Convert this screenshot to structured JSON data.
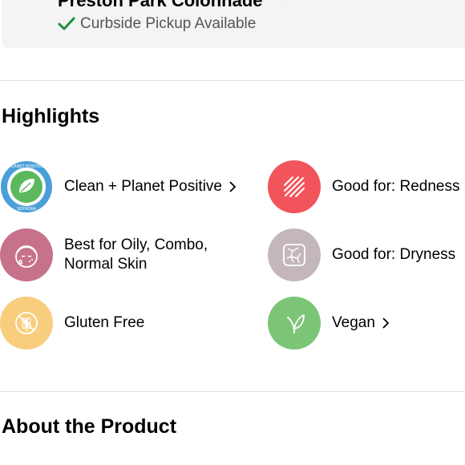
{
  "store": {
    "name": "Preston Park Colonnade",
    "pickup_text": "Curbside Pickup Available"
  },
  "highlights": {
    "title": "Highlights",
    "items": [
      {
        "label": "Clean + Planet Positive",
        "icon": "clean-planet-positive-seal-icon",
        "color": "#4a9fd8",
        "has_chevron": true
      },
      {
        "label": "Good for: Redness",
        "icon": "redness-lines-icon",
        "color": "#f2545b",
        "has_chevron": false
      },
      {
        "label": "Best for Oily, Combo, Normal Skin",
        "icon": "face-skin-icon",
        "color": "#c6728a",
        "has_chevron": false
      },
      {
        "label": "Good for: Dryness",
        "icon": "dry-skin-texture-icon",
        "color": "#c4b7bb",
        "has_chevron": false
      },
      {
        "label": "Gluten Free",
        "icon": "gluten-free-wheat-icon",
        "color": "#f8cd7d",
        "has_chevron": false
      },
      {
        "label": "Vegan",
        "icon": "vegan-leaf-icon",
        "color": "#7cc576",
        "has_chevron": true
      }
    ],
    "badge_ring_text": "CLEAN + PLANET POSITIVE · SEPHORA"
  },
  "about": {
    "title": "About the Product"
  },
  "colors": {
    "check": "#1f8f3a",
    "store_card_bg": "#f4f4f4"
  }
}
